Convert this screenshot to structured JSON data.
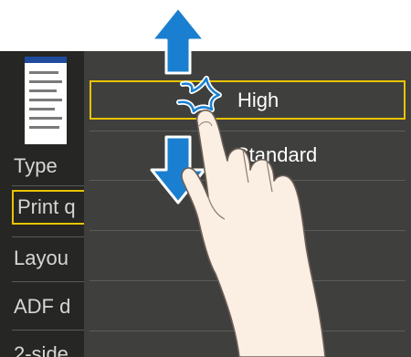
{
  "left_menu": {
    "items": [
      {
        "label": "Type"
      },
      {
        "label": "Print q"
      },
      {
        "label": "Layou"
      },
      {
        "label": "ADF d"
      },
      {
        "label": "2-side"
      }
    ]
  },
  "quality_menu": {
    "options": [
      {
        "label": "High"
      },
      {
        "label": "Standard"
      }
    ]
  },
  "icons": {
    "up_arrow": "arrow-up-icon",
    "down_arrow": "arrow-down-icon",
    "finger": "pointing-hand-icon",
    "touch": "touch-burst-icon"
  },
  "colors": {
    "arrow": "#1a7fd0",
    "highlight": "#e8c400"
  }
}
